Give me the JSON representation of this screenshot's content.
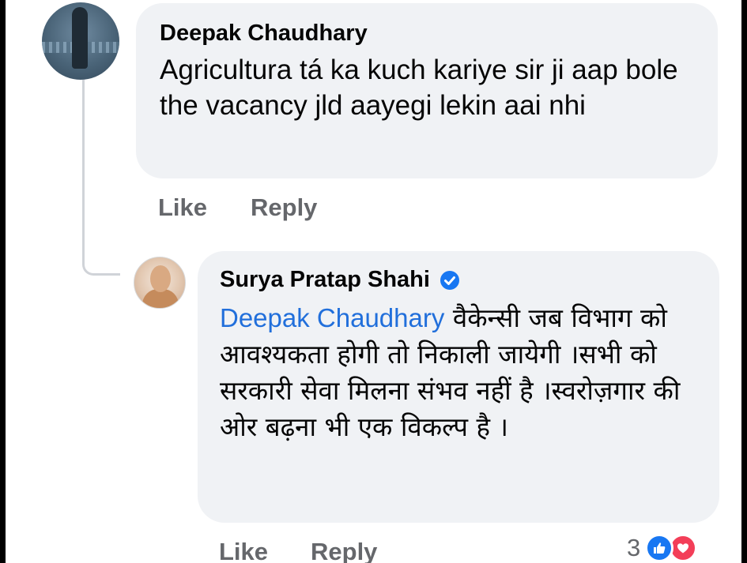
{
  "comment": {
    "author": "Deepak Chaudhary",
    "text": "Agricultura tá ka kuch kariye sir ji aap bole the vacancy jld aayegi lekin aai nhi",
    "like_label": "Like",
    "reply_label": "Reply"
  },
  "reply": {
    "author": "Surya Pratap Shahi",
    "verified_icon": "verified-badge-icon",
    "mention": "Deepak Chaudhary",
    "text": " वैकेन्सी जब विभाग को आवश्यकता होगी तो निकाली जायेगी ।सभी को सरकारी सेवा मिलना संभव नहीं है ।स्वरोज़गार की ओर बढ़ना भी एक विकल्प है ।",
    "like_label": "Like",
    "reply_label": "Reply",
    "reaction_count": "3",
    "reaction_icons": [
      "like-reaction-icon",
      "love-reaction-icon"
    ]
  },
  "colors": {
    "bubble": "#f0f2f5",
    "mention": "#216fdb",
    "meta_text": "#65676b",
    "like_blue": "#1877f2",
    "love_red": "#f33e58"
  }
}
